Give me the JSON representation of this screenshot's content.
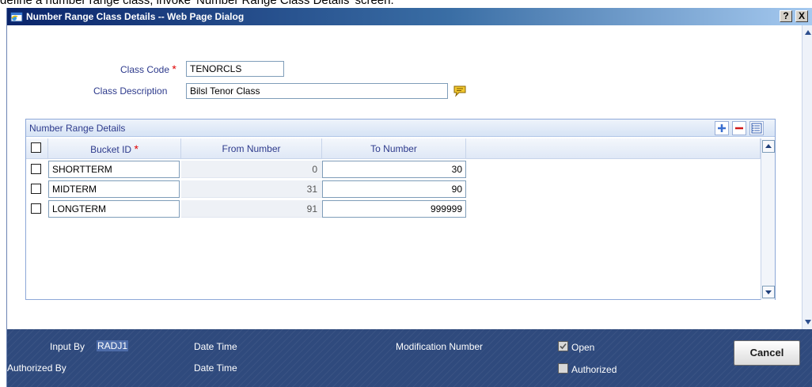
{
  "doc_caption": "define a number range class, invoke 'Number Range Class Details' screen.",
  "window": {
    "title": "Number Range Class Details -- Web Page Dialog",
    "help_label": "?",
    "close_label": "X"
  },
  "form": {
    "class_code_label": "Class Code",
    "required_mark": "*",
    "class_code_value": "TENORCLS",
    "class_description_label": "Class Description",
    "class_description_value": "Bilsl Tenor Class"
  },
  "grid": {
    "title": "Number Range Details",
    "columns": {
      "bucket_id": "Bucket ID",
      "from_number": "From Number",
      "to_number": "To Number"
    },
    "rows": [
      {
        "bucket_id": "SHORTTERM",
        "from_number": "0",
        "to_number": "30"
      },
      {
        "bucket_id": "MIDTERM",
        "from_number": "31",
        "to_number": "90"
      },
      {
        "bucket_id": "LONGTERM",
        "from_number": "91",
        "to_number": "999999"
      }
    ]
  },
  "footer": {
    "input_by_label": "Input By",
    "input_by_value": "RADJ1",
    "date_time_label": "Date Time",
    "authorized_by_label": "Authorized By",
    "modification_number_label": "Modification Number",
    "open_label": "Open",
    "authorized_label": "Authorized",
    "cancel_label": "Cancel"
  },
  "colors": {
    "title_bar": "#0a246a",
    "label_text": "#2d3a8c",
    "required": "#e00000",
    "footer_bg": "#2f4a7d",
    "grid_header": "#d6e3f5"
  }
}
